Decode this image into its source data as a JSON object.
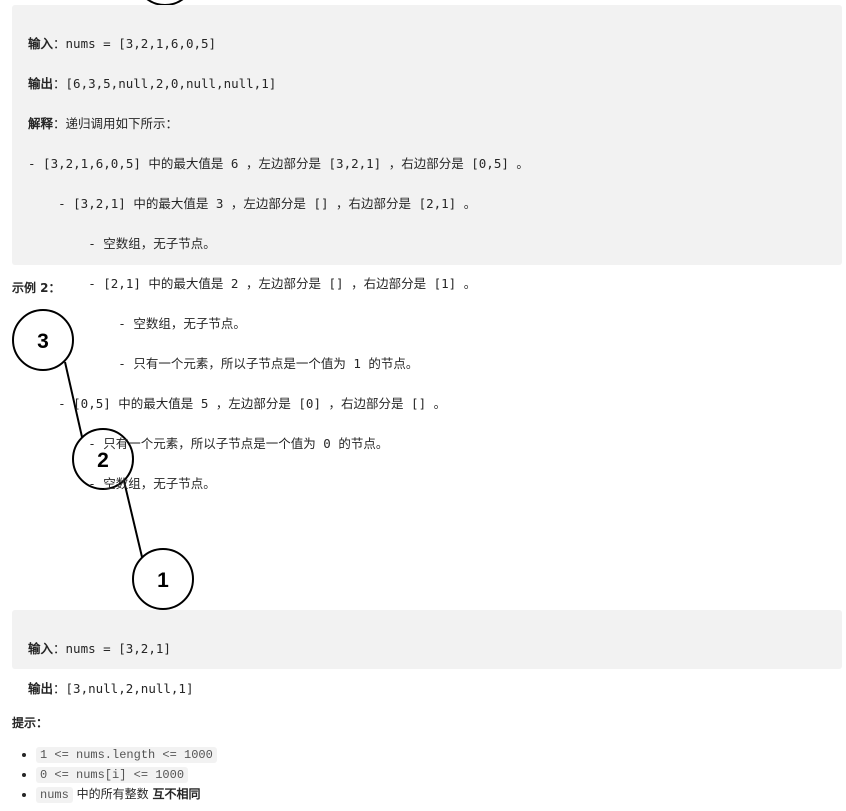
{
  "example1": {
    "input_label": "输入",
    "input": "nums = [3,2,1,6,0,5]",
    "output_label": "输出",
    "output": "[6,3,5,null,2,0,null,null,1]",
    "explain_label": "解释",
    "explain": "递归调用如下所示：",
    "lines": [
      "- [3,2,1,6,0,5] 中的最大值是 6 ，左边部分是 [3,2,1] ，右边部分是 [0,5] 。",
      "    - [3,2,1] 中的最大值是 3 ，左边部分是 [] ，右边部分是 [2,1] 。",
      "        - 空数组，无子节点。",
      "        - [2,1] 中的最大值是 2 ，左边部分是 [] ，右边部分是 [1] 。",
      "            - 空数组，无子节点。",
      "            - 只有一个元素，所以子节点是一个值为 1 的节点。",
      "    - [0,5] 中的最大值是 5 ，左边部分是 [0] ，右边部分是 [] 。",
      "        - 只有一个元素，所以子节点是一个值为 0 的节点。",
      "        - 空数组，无子节点。"
    ]
  },
  "example2": {
    "title": "示例 2：",
    "tree": [
      "3",
      "2",
      "1"
    ],
    "input_label": "输入",
    "input": "nums = [3,2,1]",
    "output_label": "输出",
    "output": "[3,null,2,null,1]"
  },
  "hints": {
    "title": "提示：",
    "items": [
      {
        "code": "1 <= nums.length <= 1000"
      },
      {
        "code": "0 <= nums[i] <= 1000"
      },
      {
        "code": "nums",
        "text": " 中的所有整数 ",
        "bold": "互不相同"
      }
    ]
  }
}
